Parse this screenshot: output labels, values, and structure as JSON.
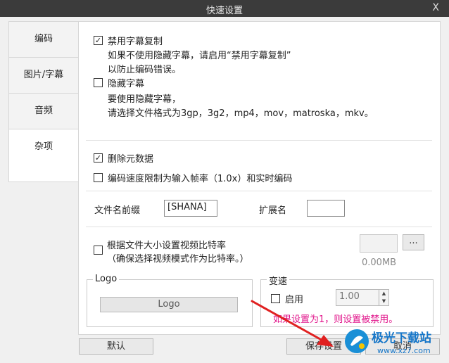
{
  "window": {
    "title": "快速设置",
    "close_label": "X"
  },
  "tabs": [
    {
      "label": "编码"
    },
    {
      "label": "图片/字幕"
    },
    {
      "label": "音频"
    },
    {
      "label": "杂项"
    }
  ],
  "subtitle": {
    "disable_copy_label": "禁用字幕复制",
    "disable_copy_checked": true,
    "disable_copy_note1": "如果不使用隐藏字幕，请启用“禁用字幕复制”",
    "disable_copy_note2": "以防止编码错误。",
    "hidden_label": "隐藏字幕",
    "hidden_checked": false,
    "hidden_note1": "要使用隐藏字幕，",
    "hidden_note2": "请选择文件格式为3gp，3g2，mp4，mov，matroska，mkv。"
  },
  "misc": {
    "delete_metadata_label": "删除元数据",
    "delete_metadata_checked": true,
    "limit_speed_label": "编码速度限制为输入帧率（1.0x）和实时编码",
    "limit_speed_checked": false,
    "filename_prefix_label": "文件名前缀",
    "filename_prefix_value": "[SHANA]",
    "extension_label": "扩展名",
    "extension_value": "",
    "bitrate_label": "根据文件大小设置视频比特率",
    "bitrate_note": "（确保选择视频模式作为比特率。）",
    "bitrate_checked": false,
    "browse_label": "...",
    "size_value": "0.00MB"
  },
  "logo": {
    "group_label": "Logo",
    "button_label": "Logo"
  },
  "speed": {
    "group_label": "变速",
    "enable_label": "启用",
    "enable_checked": false,
    "value": "1.00",
    "note": "如果设置为1，则设置被禁用。"
  },
  "footer": {
    "default_label": "默认",
    "save_label": "保存设置",
    "cancel_label": "取消"
  },
  "watermark": {
    "text": "极光下载站",
    "url": "www.xz7.com"
  },
  "colors": {
    "titlebar": "#3b3b3b",
    "accent_pink": "#e1138a",
    "arrow": "#e02020"
  }
}
